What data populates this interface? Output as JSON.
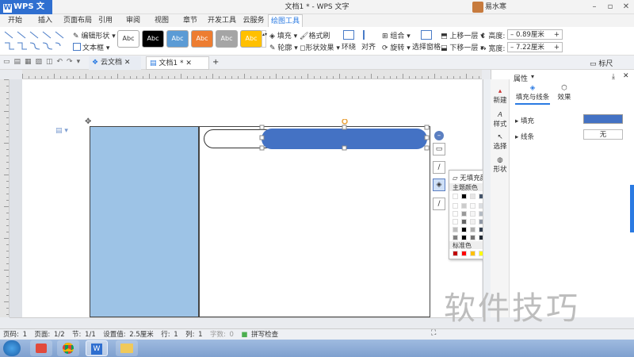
{
  "app": {
    "name": "WPS 文字",
    "title": "文档1 * - WPS 文字",
    "user": "易水寒"
  },
  "tabs": [
    "开始",
    "插入",
    "页面布局",
    "引用",
    "审阅",
    "视图",
    "章节",
    "开发工具",
    "云服务",
    "绘图工具"
  ],
  "ribbon": {
    "edit_shape": "编辑形状",
    "textbox": "文本框",
    "style_label": "Abc",
    "style_colors": [
      "#ffffff",
      "#000000",
      "#5b9bd5",
      "#ed7d31",
      "#a5a5a5",
      "#ffc000"
    ],
    "fill": "填充",
    "format_painter": "格式刷",
    "outline": "轮廓",
    "shape_effect": "形状效果",
    "wrap": "环绕",
    "align": "对齐",
    "group": "组合",
    "rotate": "旋转",
    "select_pane": "选择窗格",
    "bring_forward": "上移一层",
    "send_backward": "下移一层",
    "height_label": "高度:",
    "height_value": "0.89厘米",
    "width_label": "宽度:",
    "width_value": "7.22厘米"
  },
  "doc_tabs": {
    "cloud": "云文档",
    "doc": "文档1 *",
    "ruler": "标尺"
  },
  "panel": {
    "title": "属性",
    "tab_fill": "填充与线条",
    "tab_effect": "效果",
    "fill_label": "填充",
    "fill_color": "#4472c4",
    "line_label": "线条",
    "line_value": "无",
    "side": [
      "新建",
      "样式",
      "选择",
      "形状"
    ]
  },
  "popup": {
    "no_fill": "无填充颜色",
    "theme_colors": "主题颜色",
    "standard_colors": "标准色",
    "theme_row": [
      "#ffffff",
      "#000000",
      "#e7e6e6",
      "#44546a",
      "#4472c4",
      "#ed7d31",
      "#a5a5a5",
      "#ffc000",
      "#5b9bd5",
      "#70ad47"
    ],
    "standard_row": [
      "#c00000",
      "#ff0000",
      "#ffc000",
      "#ffff00",
      "#92d050",
      "#00b050",
      "#00b0f0",
      "#0070c0",
      "#002060",
      "#7030a0"
    ]
  },
  "status": {
    "page": "页码: 1",
    "pages": "页面: 1/2",
    "section": "节: 1/1",
    "setting": "设置值: 2.5厘米",
    "row": "行: 1",
    "col": "列: 1",
    "words": "字数: 0",
    "spell": "拼写检查"
  },
  "watermark": "软件技巧",
  "shapes": {
    "left_rect_color": "#9dc3e6",
    "rounded_fill": "#4472c4"
  }
}
